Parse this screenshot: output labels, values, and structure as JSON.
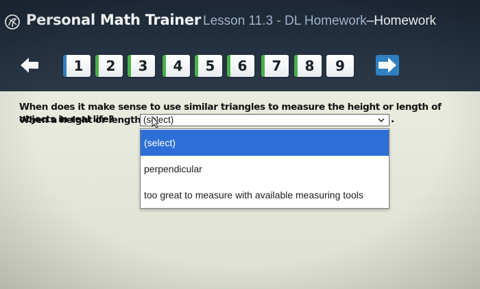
{
  "app": {
    "brand": "Personal Math Trainer",
    "lesson_prefix": "Lesson 11.3 - DL Homework",
    "lesson_suffix": "Homework",
    "separator": "–"
  },
  "nav": {
    "prev_icon": "left-arrow-icon",
    "next_icon": "right-arrow-icon",
    "pages": [
      "1",
      "2",
      "3",
      "4",
      "5",
      "6",
      "7",
      "8",
      "9"
    ],
    "selected_page": "1",
    "completed_pages": [
      "2",
      "3",
      "4",
      "5",
      "6",
      "7",
      "8"
    ]
  },
  "question": {
    "prompt": "When does it make sense to use similar triangles to measure the height or length of objects in real life?",
    "answer_lead": "When a height or length is",
    "select_value": "(select)",
    "end_punct": "."
  },
  "dropdown": {
    "options": [
      "(select)",
      "perpendicular",
      "too great to measure with available measuring tools"
    ],
    "highlighted_index": 0
  },
  "colors": {
    "header_bg": "#253242",
    "accent_blue": "#2f7fc1",
    "done_green": "#49b04a",
    "highlight": "#2d6fd6"
  }
}
